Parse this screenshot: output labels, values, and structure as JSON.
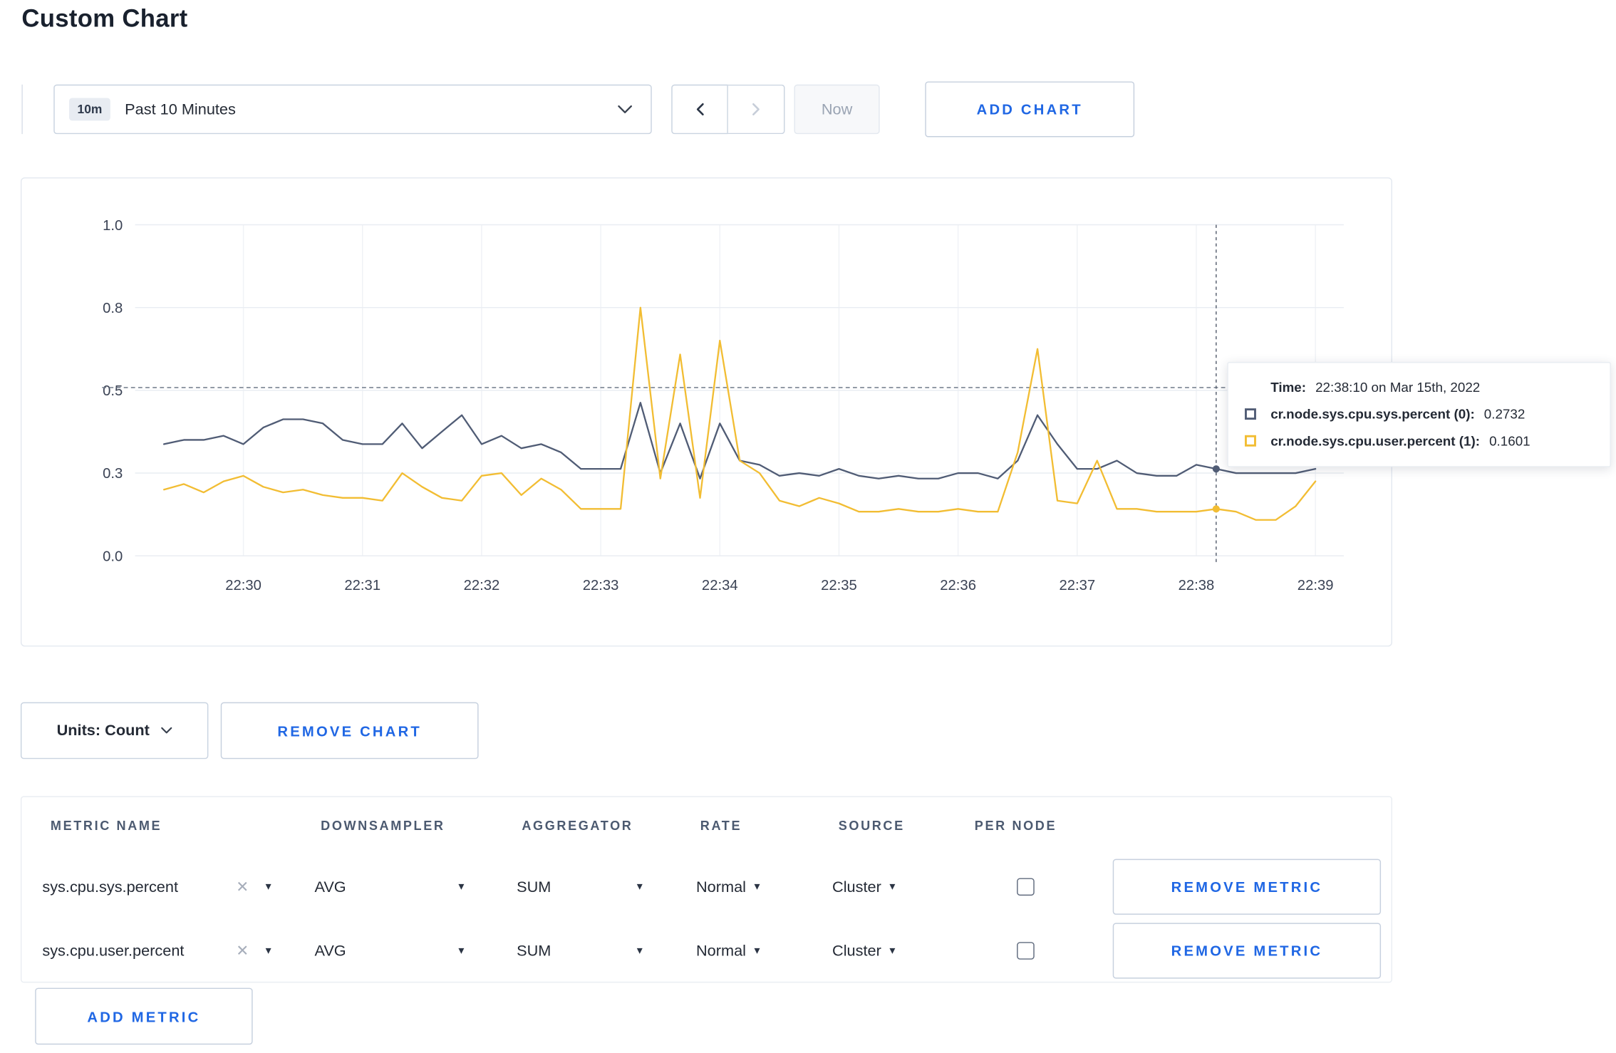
{
  "page": {
    "title": "Custom Chart"
  },
  "theme": {
    "accent": "#2067e4",
    "series_sys_color": "#505c75",
    "series_user_color": "#f2bd33"
  },
  "toolbar": {
    "time_selector": {
      "badge": "10m",
      "label": "Past 10 Minutes"
    },
    "now_label": "Now",
    "add_chart_label": "ADD CHART"
  },
  "chart": {
    "tooltip": {
      "time_label": "Time:",
      "time_value": "22:38:10 on Mar 15th, 2022",
      "series": [
        {
          "label": "cr.node.sys.cpu.sys.percent (0):",
          "value": "0.2732"
        },
        {
          "label": "cr.node.sys.cpu.user.percent (1):",
          "value": "0.1601"
        }
      ]
    }
  },
  "chart_data": {
    "type": "line",
    "title": "",
    "xlabel": "",
    "ylabel": "",
    "grid": true,
    "x_tick_labels": [
      "22:30",
      "22:31",
      "22:32",
      "22:33",
      "22:34",
      "22:35",
      "22:36",
      "22:37",
      "22:38",
      "22:39"
    ],
    "y_tick_labels": [
      "1.0",
      "0.8",
      "0.5",
      "0.3",
      "0.0"
    ],
    "y_tick_values": [
      1.0,
      0.8,
      0.5,
      0.3,
      0.0
    ],
    "start_time": "22:29:20",
    "step_seconds": 10,
    "crosshair_time": "22:38:10",
    "guide_value": 0.51,
    "series": [
      {
        "name": "cr.node.sys.cpu.sys.percent",
        "color": "#505c75",
        "values": [
          0.37,
          0.38,
          0.38,
          0.39,
          0.37,
          0.41,
          0.43,
          0.43,
          0.42,
          0.38,
          0.37,
          0.37,
          0.42,
          0.36,
          0.4,
          0.44,
          0.37,
          0.39,
          0.36,
          0.37,
          0.35,
          0.31,
          0.31,
          0.31,
          0.47,
          0.3,
          0.42,
          0.28,
          0.42,
          0.33,
          0.32,
          0.29,
          0.3,
          0.29,
          0.31,
          0.29,
          0.28,
          0.29,
          0.28,
          0.28,
          0.3,
          0.3,
          0.28,
          0.33,
          0.44,
          0.37,
          0.31,
          0.31,
          0.33,
          0.3,
          0.29,
          0.29,
          0.32,
          0.31,
          0.3,
          0.3,
          0.3,
          0.3,
          0.31
        ]
      },
      {
        "name": "cr.node.sys.cpu.user.percent",
        "color": "#f2bd33",
        "values": [
          0.24,
          0.26,
          0.23,
          0.27,
          0.29,
          0.25,
          0.23,
          0.24,
          0.22,
          0.21,
          0.21,
          0.2,
          0.3,
          0.25,
          0.21,
          0.2,
          0.29,
          0.3,
          0.22,
          0.28,
          0.24,
          0.17,
          0.17,
          0.17,
          0.8,
          0.28,
          0.63,
          0.21,
          0.68,
          0.33,
          0.3,
          0.2,
          0.18,
          0.21,
          0.19,
          0.16,
          0.16,
          0.17,
          0.16,
          0.16,
          0.17,
          0.16,
          0.16,
          0.35,
          0.65,
          0.2,
          0.19,
          0.33,
          0.17,
          0.17,
          0.16,
          0.16,
          0.16,
          0.17,
          0.16,
          0.13,
          0.13,
          0.18,
          0.27
        ]
      }
    ]
  },
  "controls": {
    "units_label": "Units: Count",
    "remove_chart_label": "REMOVE CHART",
    "remove_metric_label": "REMOVE METRIC",
    "add_metric_label": "ADD METRIC"
  },
  "metrics_table": {
    "headers": [
      "METRIC NAME",
      "DOWNSAMPLER",
      "AGGREGATOR",
      "RATE",
      "SOURCE",
      "PER NODE"
    ],
    "rows": [
      {
        "metric": "sys.cpu.sys.percent",
        "downsampler": "AVG",
        "aggregator": "SUM",
        "rate": "Normal",
        "source": "Cluster",
        "per_node": false
      },
      {
        "metric": "sys.cpu.user.percent",
        "downsampler": "AVG",
        "aggregator": "SUM",
        "rate": "Normal",
        "source": "Cluster",
        "per_node": false
      }
    ]
  }
}
